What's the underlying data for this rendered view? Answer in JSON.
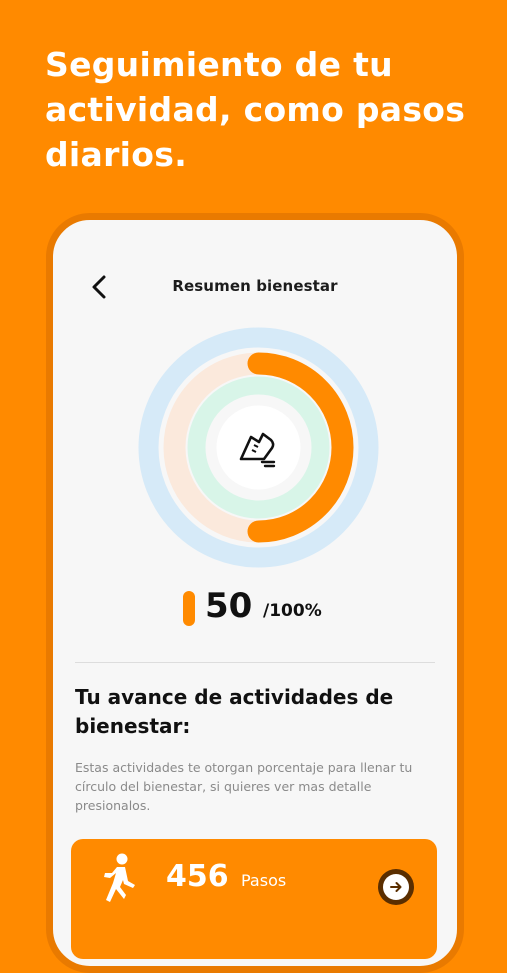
{
  "headline": "Seguimiento de tu actividad, como pasos diarios.",
  "header": {
    "title": "Resumen bienestar"
  },
  "progress": {
    "value": "50",
    "suffix": "/100%",
    "fraction": 0.5
  },
  "section": {
    "title": "Tu avance de actividades de bienestar:",
    "description": "Estas actividades te otorgan porcentaje para llenar tu círculo del bienestar, si quieres ver mas detalle presionalos."
  },
  "steps_card": {
    "value": "456",
    "label": "Pasos"
  },
  "colors": {
    "brand": "#FF8A00",
    "ring_outer": "#D6EAF8",
    "ring_middle": "#FBE9DC",
    "ring_inner": "#D8F5E8"
  },
  "icons": {
    "back": "chevron-left-icon",
    "center": "sneaker-icon",
    "activity": "walking-person-icon",
    "card_action": "arrow-right-icon"
  }
}
